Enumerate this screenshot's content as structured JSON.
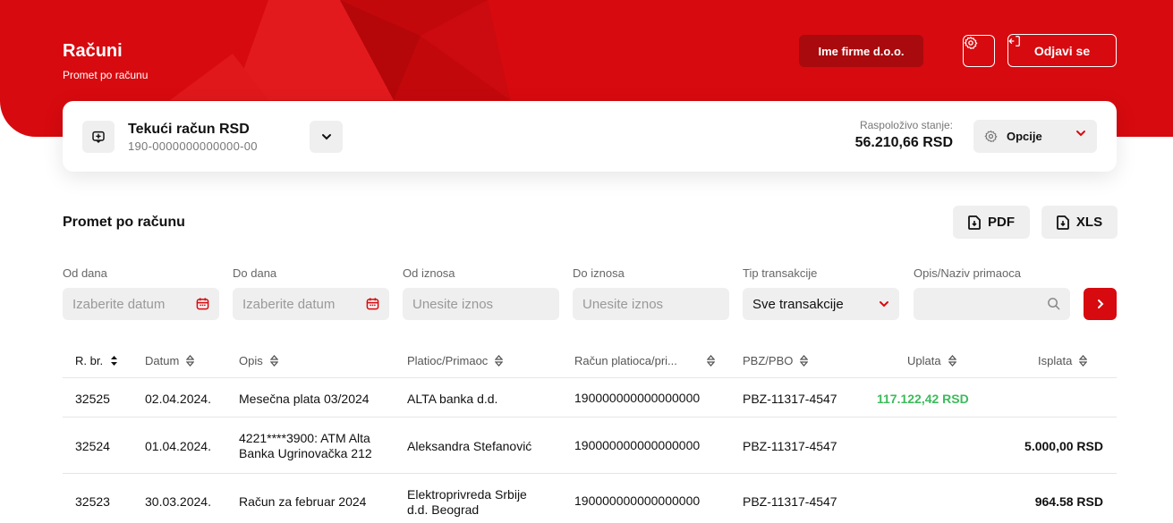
{
  "header": {
    "title": "Računi",
    "subtitle": "Promet po računu",
    "company": "Ime firme d.o.o.",
    "logout": "Odjavi se"
  },
  "account": {
    "name": "Tekući račun RSD",
    "number": "190-0000000000000-00",
    "balance_label": "Raspoloživo stanje:",
    "balance_value": "56.210,66 RSD",
    "options_label": "Opcije"
  },
  "section": {
    "title": "Promet po računu",
    "pdf_label": "PDF",
    "xls_label": "XLS"
  },
  "filters": {
    "from_date_label": "Od dana",
    "from_date_placeholder": "Izaberite datum",
    "to_date_label": "Do dana",
    "to_date_placeholder": "Izaberite datum",
    "from_amount_label": "Od iznosa",
    "from_amount_placeholder": "Unesite iznos",
    "to_amount_label": "Do iznosa",
    "to_amount_placeholder": "Unesite iznos",
    "type_label": "Tip transakcije",
    "type_value": "Sve transakcije",
    "search_label": "Opis/Naziv primaoca"
  },
  "table": {
    "columns": [
      "R. br.",
      "Datum",
      "Opis",
      "Platioc/Primaoc",
      "Račun platioca/pri...",
      "PBZ/PBO",
      "Uplata",
      "Isplata"
    ],
    "rows": [
      {
        "no": "32525",
        "date": "02.04.2024.",
        "desc1": "Mesečna plata 03/2024",
        "desc2": "",
        "party1": "ALTA banka d.d.",
        "party2": "",
        "account": "190000000000000000",
        "pbz": "PBZ-11317-4547",
        "in": "117.122,42 RSD",
        "out": ""
      },
      {
        "no": "32524",
        "date": "01.04.2024.",
        "desc1": "4221****3900: ATM Alta",
        "desc2": "Banka Ugrinovačka 212",
        "party1": "Aleksandra Stefanović",
        "party2": "",
        "account": "190000000000000000",
        "pbz": "PBZ-11317-4547",
        "in": "",
        "out": "5.000,00 RSD"
      },
      {
        "no": "32523",
        "date": "30.03.2024.",
        "desc1": "Račun za februar 2024",
        "desc2": "",
        "party1": "Elektroprivreda Srbije",
        "party2": "d.d. Beograd",
        "account": "190000000000000000",
        "pbz": "PBZ-11317-4547",
        "in": "",
        "out": "964.58 RSD"
      }
    ]
  },
  "colors": {
    "brand_red": "#d70a0f",
    "income_green": "#3dbb5c"
  }
}
